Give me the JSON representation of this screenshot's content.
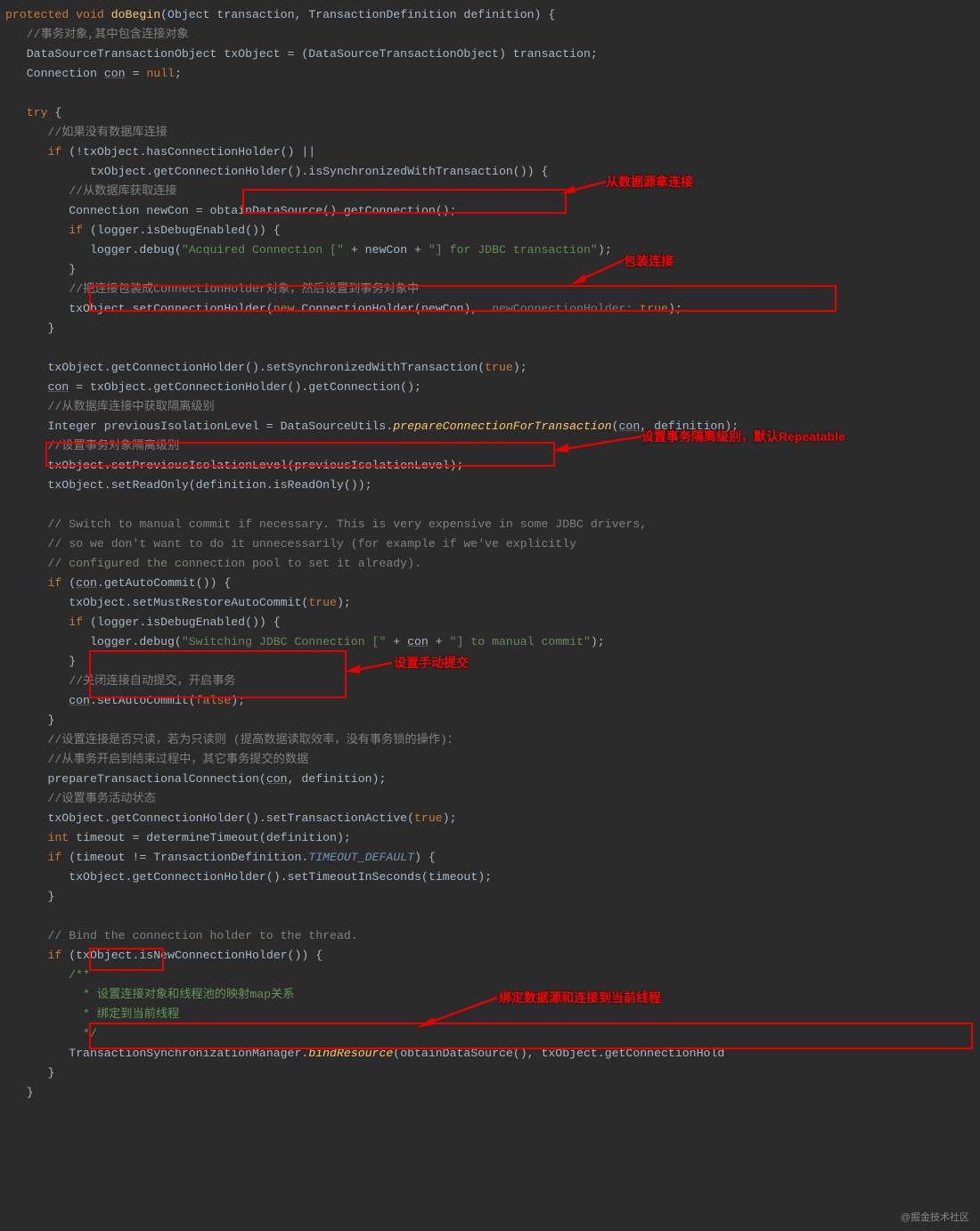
{
  "code": {
    "sig": "protected void doBegin(Object transaction, TransactionDefinition definition) {",
    "c1": "//事务对象,其中包含连接对象",
    "l2": "DataSourceTransactionObject txObject = (DataSourceTransactionObject) transaction;",
    "l3": "Connection con = null;",
    "try": "try {",
    "c4": "//如果没有数据库连接",
    "l5a": "if (!txObject.hasConnectionHolder() ||",
    "l5b": "txObject.getConnectionHolder().isSynchronizedWithTransaction()) {",
    "c6": "//从数据库获取连接",
    "l7": "Connection newCon = obtainDataSource().getConnection();",
    "l8": "if (logger.isDebugEnabled()) {",
    "l9": "logger.debug(\"Acquired Connection [\" + newCon + \"] for JDBC transaction\");",
    "c10": "//把连接包装成ConnectionHolder对象，然后设置到事务对象中",
    "l11": "txObject.setConnectionHolder(new ConnectionHolder(newCon),  newConnectionHolder: true);",
    "l12": "txObject.getConnectionHolder().setSynchronizedWithTransaction(true);",
    "l13": "con = txObject.getConnectionHolder().getConnection();",
    "c14": "//从数据库连接中获取隔离级别",
    "l15": "Integer previousIsolationLevel = DataSourceUtils.prepareConnectionForTransaction(con, definition);",
    "c16": "//设置事务对象隔离级别",
    "l17": "txObject.setPreviousIsolationLevel(previousIsolationLevel);",
    "l18": "txObject.setReadOnly(definition.isReadOnly());",
    "c19": "// Switch to manual commit if necessary. This is very expensive in some JDBC drivers,",
    "c20": "// so we don't want to do it unnecessarily (for example if we've explicitly",
    "c21": "// configured the connection pool to set it already).",
    "l22": "if (con.getAutoCommit()) {",
    "l23": "txObject.setMustRestoreAutoCommit(true);",
    "l24": "if (logger.isDebugEnabled()) {",
    "l25": "logger.debug(\"Switching JDBC Connection [\" + con + \"] to manual commit\");",
    "c26": "//关闭连接自动提交，开启事务",
    "l27": "con.setAutoCommit(false);",
    "c28": "//设置连接是否只读，若为只读则 (提高数据读取效率，没有事务锁的操作)：",
    "c29": "//从事务开启到结束过程中，其它事务提交的数据",
    "l30": "prepareTransactionalConnection(con, definition);",
    "c31": "//设置事务活动状态",
    "l32": "txObject.getConnectionHolder().setTransactionActive(true);",
    "l33": "int timeout = determineTimeout(definition);",
    "l34": "if (timeout != TransactionDefinition.TIMEOUT_DEFAULT) {",
    "l35": "txObject.getConnectionHolder().setTimeoutInSeconds(timeout);",
    "c36": "// Bind the connection holder to the thread.",
    "l37": "if (txObject.isNewConnectionHolder()) {",
    "doc1": "/**",
    "doc2": " * 设置连接对象和线程池的映射map关系",
    "doc3": " * 绑定到当前线程",
    "doc4": " */",
    "l38": "TransactionSynchronizationManager.bindResource(obtainDataSource(), txObject.getConnectionHold"
  },
  "annotations": {
    "a1": "从数据源拿连接",
    "a2": "包装连接",
    "a3": "设置事务隔离级别，默认Repeatable",
    "a4": "设置手动提交",
    "a5": "绑定数据源和连接到当前线程"
  },
  "watermark": "@掘金技术社区"
}
